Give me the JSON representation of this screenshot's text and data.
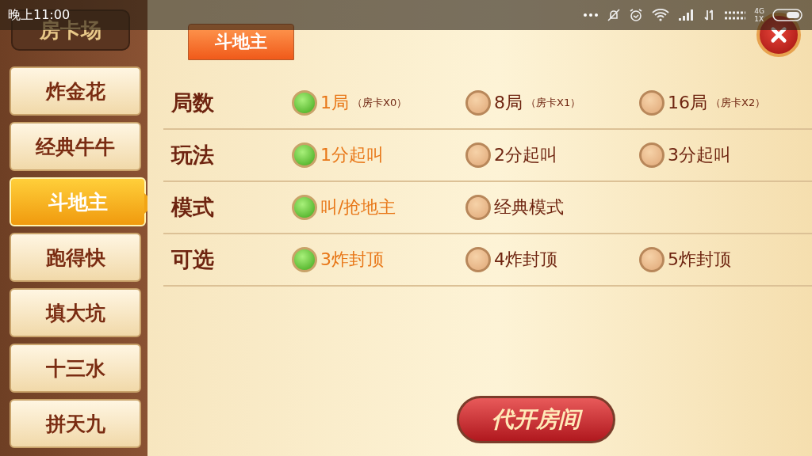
{
  "status_bar": {
    "time": "晚上11:00",
    "network_top": "4G",
    "network_bottom": "1X"
  },
  "sidebar": {
    "title": "房卡场",
    "items": [
      {
        "label": "炸金花",
        "selected": false
      },
      {
        "label": "经典牛牛",
        "selected": false
      },
      {
        "label": "斗地主",
        "selected": true
      },
      {
        "label": "跑得快",
        "selected": false
      },
      {
        "label": "填大坑",
        "selected": false
      },
      {
        "label": "十三水",
        "selected": false
      },
      {
        "label": "拼天九",
        "selected": false
      }
    ]
  },
  "tab": {
    "label": "斗地主",
    "selected": true
  },
  "settings": [
    {
      "label": "局数",
      "options": [
        {
          "text": "1局",
          "note": "（房卡X0）",
          "selected": true
        },
        {
          "text": "8局",
          "note": "（房卡X1）",
          "selected": false
        },
        {
          "text": "16局",
          "note": "（房卡X2）",
          "selected": false
        }
      ]
    },
    {
      "label": "玩法",
      "options": [
        {
          "text": "1分起叫",
          "selected": true
        },
        {
          "text": "2分起叫",
          "selected": false
        },
        {
          "text": "3分起叫",
          "selected": false
        }
      ]
    },
    {
      "label": "模式",
      "options": [
        {
          "text": "叫/抢地主",
          "selected": true
        },
        {
          "text": "经典模式",
          "selected": false
        }
      ]
    },
    {
      "label": "可选",
      "options": [
        {
          "text": "3炸封顶",
          "selected": true
        },
        {
          "text": "4炸封顶",
          "selected": false
        },
        {
          "text": "5炸封顶",
          "selected": false
        }
      ]
    }
  ],
  "action_button": {
    "label": "代开房间"
  }
}
